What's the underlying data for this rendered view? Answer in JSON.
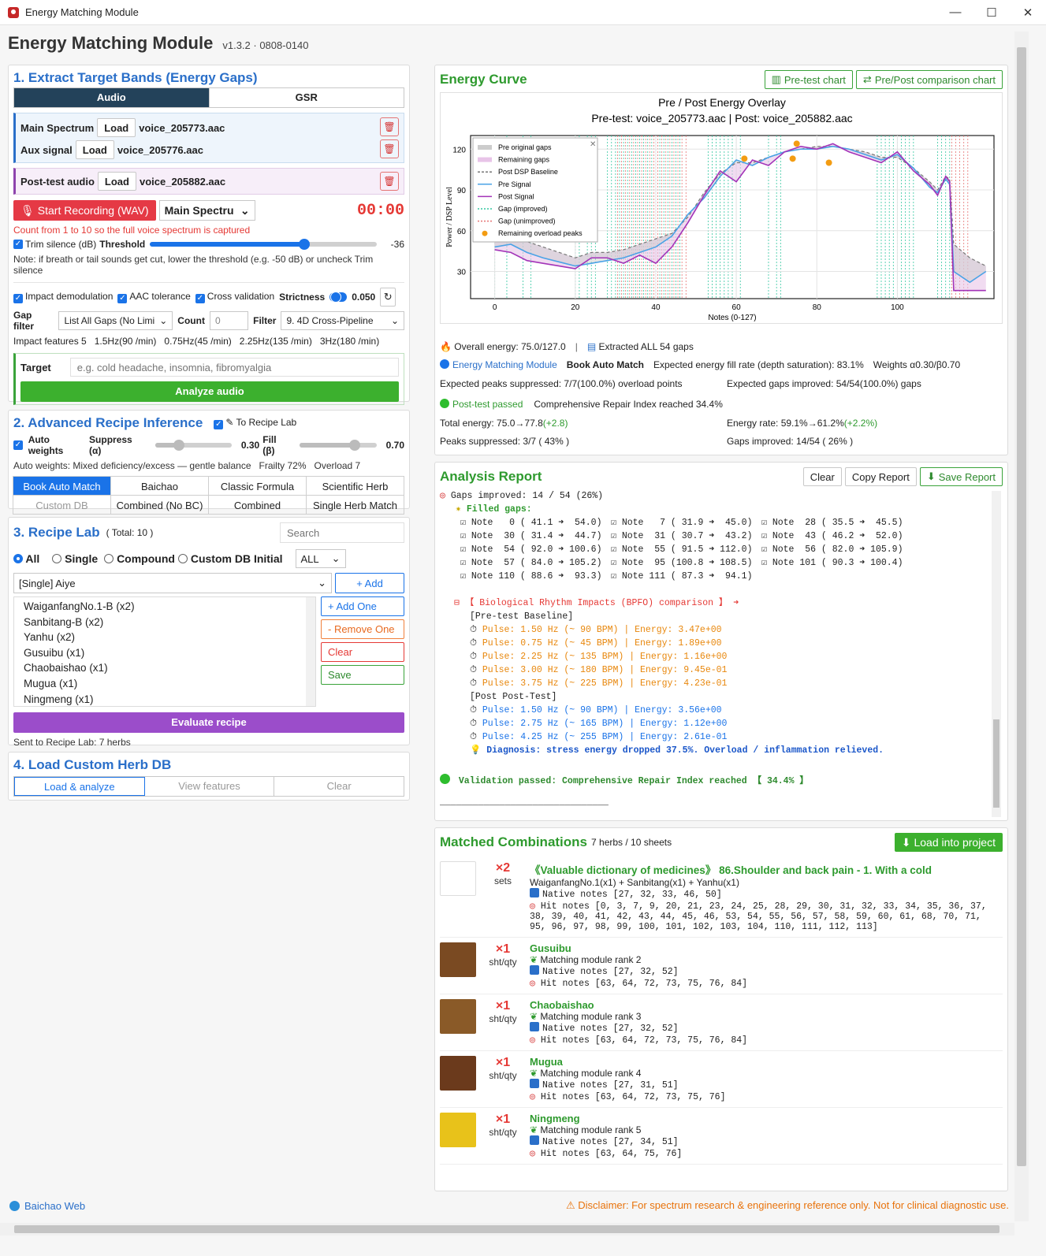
{
  "window": {
    "title": "Energy Matching Module",
    "minimize": "—",
    "maximize": "☐",
    "close": "✕"
  },
  "header": {
    "title": "Energy Matching Module",
    "version": "v1.3.2 · 0808-0140"
  },
  "s1": {
    "title": "1. Extract Target Bands (Energy Gaps)",
    "tabs": [
      "Audio",
      "GSR"
    ],
    "main_label": "Main Spectrum",
    "main_file": "voice_205773.aac",
    "aux_label": "Aux signal",
    "aux_file": "voice_205776.aac",
    "post_label": "Post-test audio",
    "post_file": "voice_205882.aac",
    "load": "Load",
    "record": "Start Recording (WAV)",
    "channel": "Main Spectru",
    "timer": "00:00",
    "hint": "Count from 1 to 10 so the full voice spectrum is captured",
    "trim": "Trim silence (dB)",
    "threshold_label": "Threshold",
    "threshold_value": "-36",
    "threshold_level": 0.68,
    "note": "Note: if breath or tail sounds get cut, lower the threshold (e.g. -50 dB) or uncheck Trim silence",
    "impact": "Impact demodulation",
    "aac": "AAC tolerance",
    "cross": "Cross validation",
    "strictness_label": "Strictness",
    "strictness": "0.050",
    "gapfilter_label": "Gap filter",
    "gapfilter": "List All Gaps (No Limi",
    "count_label": "Count",
    "count": "0",
    "filter_label": "Filter",
    "filter": "9. 4D Cross-Pipeline",
    "features": [
      "Impact features 5",
      "1.5Hz(90 /min)",
      "0.75Hz(45 /min)",
      "2.25Hz(135 /min)",
      "3Hz(180 /min)"
    ],
    "target_label": "Target",
    "target_placeholder": "e.g. cold headache, insomnia, fibromyalgia",
    "analyze": "Analyze audio"
  },
  "s2": {
    "title": "2. Advanced Recipe Inference",
    "to_lab": "To Recipe Lab",
    "auto": "Auto weights",
    "suppress_label": "Suppress (α)",
    "suppress": "0.30",
    "fill_label": "Fill (β)",
    "fill": "0.70",
    "suppress_level": 0.3,
    "fill_level": 0.7,
    "desc": "Auto weights: Mixed deficiency/excess — gentle balance",
    "frailty": "Frailty 72%",
    "overload": "Overload 7",
    "modes": [
      "Book Auto Match",
      "Baichao",
      "Classic Formula",
      "Scientific Herb",
      "Custom DB",
      "Combined (No BC)",
      "Combined",
      "Single Herb Match"
    ]
  },
  "s3": {
    "title": "3. Recipe Lab",
    "total": "( Total: 10 )",
    "search_placeholder": "Search",
    "radios": [
      "All",
      "Single",
      "Compound",
      "Custom DB Initial"
    ],
    "initial": "ALL",
    "selected": "[Single] Aiye",
    "add": "+ Add",
    "items": [
      "WaiganfangNo.1-B (x2)",
      "Sanbitang-B (x2)",
      "Yanhu (x2)",
      "Gusuibu (x1)",
      "Chaobaishao (x1)",
      "Mugua (x1)",
      "Ningmeng (x1)"
    ],
    "add_one": "+ Add One",
    "remove_one": "- Remove One",
    "clear": "Clear",
    "save": "Save",
    "evaluate": "Evaluate recipe",
    "sent": "Sent to Recipe Lab: 7 herbs"
  },
  "s4": {
    "title": "4. Load Custom Herb DB",
    "buttons": [
      "Load & analyze",
      "View features",
      "Clear"
    ]
  },
  "curve": {
    "title": "Energy Curve",
    "pretest_btn": "Pre-test chart",
    "compare_btn": "Pre/Post comparison chart",
    "overall": "Overall energy: 75.0/127.0",
    "extracted": "Extracted ALL 54 gaps",
    "module": "Energy Matching Module",
    "book": "Book Auto Match",
    "fill_rate": "Expected energy fill rate (depth saturation): 83.1%",
    "weights": "Weights α0.30/β0.70",
    "peaks_expected": "Expected peaks suppressed: 7/7(100.0%) overload points",
    "gaps_expected": "Expected gaps improved: 54/54(100.0%) gaps",
    "passed": "Post-test passed",
    "repair": "Comprehensive Repair Index reached 34.4%",
    "total_energy": "Total energy: 75.0→77.8",
    "total_delta": "(+2.8)",
    "energy_rate": "Energy rate: 59.1%→61.2%",
    "rate_delta": "(+2.2%)",
    "peaks_supp": "Peaks suppressed: 3/7 ( 43% )",
    "gaps_impr": "Gaps improved: 14/54 ( 26% )"
  },
  "chart_data": {
    "type": "line",
    "title": "Pre / Post Energy Overlay",
    "subtitle": "Pre-test: voice_205773.aac   |   Post: voice_205882.aac",
    "xlabel": "Notes (0-127)",
    "ylabel": "Power / DSP Level",
    "xlim": [
      -6,
      124
    ],
    "ylim": [
      10,
      130
    ],
    "xticks": [
      0,
      20,
      40,
      60,
      80,
      100
    ],
    "yticks": [
      30,
      60,
      90,
      120
    ],
    "legend": [
      "Pre original gaps",
      "Remaining gaps",
      "Post DSP Baseline",
      "Pre Signal",
      "Post Signal",
      "Gap (improved)",
      "Gap (unimproved)",
      "Remaining overload peaks"
    ],
    "legend_position": "top-left",
    "colors": {
      "pre": "#4aa3e6",
      "post": "#a334b8",
      "baseline": "#777777",
      "improved": "#33c7a0",
      "unimproved": "#e57373",
      "peak": "#f39c12",
      "gapfill": "#cccccc",
      "remfill": "#e8c4e8"
    },
    "improved_gaps": [
      0,
      3,
      7,
      9,
      20,
      21,
      23,
      24,
      25,
      28,
      29,
      30,
      31,
      32,
      33,
      34,
      35,
      36,
      37,
      38,
      39,
      40,
      41,
      42,
      43,
      44,
      45,
      46,
      53,
      54,
      55,
      56,
      57,
      58,
      59,
      60,
      61,
      68,
      70,
      71,
      95,
      96,
      97,
      98,
      99,
      100,
      101,
      102,
      103,
      104,
      110,
      111,
      112,
      113
    ],
    "unimproved_gaps": [
      30,
      31,
      32,
      33,
      34,
      35,
      36,
      37,
      38,
      39,
      40,
      41,
      42,
      43,
      44,
      45,
      46,
      47,
      113,
      114,
      115,
      116,
      117
    ],
    "pre": {
      "x": [
        0,
        4,
        8,
        12,
        16,
        20,
        24,
        28,
        32,
        36,
        40,
        44,
        48,
        52,
        56,
        60,
        64,
        68,
        72,
        76,
        80,
        84,
        88,
        92,
        96,
        100,
        104,
        108,
        110,
        112,
        113,
        114,
        118,
        122
      ],
      "y": [
        48,
        50,
        44,
        40,
        37,
        34,
        36,
        38,
        40,
        44,
        48,
        56,
        72,
        84,
        100,
        112,
        108,
        114,
        118,
        120,
        120,
        122,
        120,
        116,
        112,
        116,
        106,
        92,
        88,
        98,
        94,
        30,
        22,
        30
      ]
    },
    "post": {
      "x": [
        0,
        4,
        8,
        12,
        16,
        20,
        24,
        28,
        32,
        36,
        40,
        44,
        48,
        52,
        56,
        60,
        64,
        68,
        72,
        76,
        80,
        84,
        88,
        92,
        96,
        100,
        104,
        108,
        110,
        112,
        113,
        114,
        118,
        122
      ],
      "y": [
        46,
        44,
        38,
        36,
        34,
        32,
        40,
        40,
        36,
        42,
        36,
        48,
        66,
        86,
        104,
        96,
        112,
        108,
        118,
        122,
        120,
        124,
        118,
        114,
        110,
        118,
        104,
        94,
        86,
        100,
        96,
        16,
        16,
        16
      ]
    },
    "baseline": {
      "x": [
        0,
        4,
        8,
        12,
        16,
        20,
        24,
        28,
        32,
        36,
        40,
        44,
        48,
        52,
        56,
        60,
        64,
        68,
        72,
        76,
        80,
        84,
        88,
        92,
        96,
        100,
        104,
        108,
        110,
        112,
        113,
        114,
        118,
        122
      ],
      "y": [
        52,
        54,
        52,
        48,
        44,
        40,
        44,
        44,
        46,
        50,
        54,
        58,
        70,
        88,
        102,
        110,
        110,
        114,
        118,
        120,
        122,
        122,
        120,
        118,
        114,
        114,
        106,
        96,
        90,
        100,
        98,
        50,
        40,
        34
      ]
    },
    "peaks": {
      "x": [
        62,
        74,
        75,
        83
      ],
      "y": [
        113,
        113,
        124,
        110
      ]
    }
  },
  "report": {
    "title": "Analysis Report",
    "clear": "Clear",
    "copy": "Copy Report",
    "save": "Save Report",
    "gaps_line": "Gaps improved: 14 / 54 (26%)",
    "filled": "Filled gaps:",
    "notes_rows": [
      [
        "☑ Note   0 ( 41.1 ➜  54.0)",
        "☑ Note   7 ( 31.9 ➜  45.0)",
        "☑ Note  28 ( 35.5 ➜  45.5)"
      ],
      [
        "☑ Note  30 ( 31.4 ➜  44.7)",
        "☑ Note  31 ( 30.7 ➜  43.2)",
        "☑ Note  43 ( 46.2 ➜  52.0)"
      ],
      [
        "☑ Note  54 ( 92.0 ➜ 100.6)",
        "☑ Note  55 ( 91.5 ➜ 112.0)",
        "☑ Note  56 ( 82.0 ➜ 105.9)"
      ],
      [
        "☑ Note  57 ( 84.0 ➜ 105.2)",
        "☑ Note  95 (100.8 ➜ 108.5)",
        "☑ Note 101 ( 90.3 ➜ 100.4)"
      ],
      [
        "☑ Note 110 ( 88.6 ➜  93.3)",
        "☑ Note 111 ( 87.3 ➜  94.1)",
        ""
      ]
    ],
    "bpfo": "【 Biological Rhythm Impacts (BPFO) comparison 】 ➜",
    "pre_head": "[Pre-test Baseline]",
    "pre_lines": [
      "Pulse: 1.50 Hz (~ 90 BPM) | Energy: 3.47e+00",
      "Pulse: 0.75 Hz (~ 45 BPM) | Energy: 1.89e+00",
      "Pulse: 2.25 Hz (~ 135 BPM) | Energy: 1.16e+00",
      "Pulse: 3.00 Hz (~ 180 BPM) | Energy: 9.45e-01",
      "Pulse: 3.75 Hz (~ 225 BPM) | Energy: 4.23e-01"
    ],
    "post_head": "[Post Post-Test]",
    "post_lines": [
      "Pulse: 1.50 Hz (~ 90 BPM) | Energy: 3.56e+00",
      "Pulse: 2.75 Hz (~ 165 BPM) | Energy: 1.12e+00",
      "Pulse: 4.25 Hz (~ 255 BPM) | Energy: 2.61e-01"
    ],
    "diagnosis": "Diagnosis: stress energy dropped 37.5%. Overload / inflammation relieved.",
    "validation": "Validation passed: Comprehensive Repair Index reached 【 34.4% 】",
    "rule": "_______________________________"
  },
  "matched": {
    "title": "Matched Combinations",
    "sub": "7 herbs / 10 sheets",
    "load": "Load into project",
    "first": {
      "qty": "×2",
      "unit": "sets",
      "name": "《Valuable dictionary of medicines》 86.Shoulder and back pain - 1. With a cold",
      "formula": "WaiganfangNo.1(x1) + Sanbitang(x1) + Yanhu(x1)",
      "native": "Native notes [27, 32, 33, 46, 50]",
      "hits": "Hit notes [0, 3, 7, 9, 20, 21, 23, 24, 25, 28, 29, 30, 31, 32, 33, 34, 35, 36, 37, 38, 39, 40, 41, 42, 43, 44, 45, 46, 53, 54, 55, 56, 57, 58, 59, 60, 61, 68, 70, 71, 95, 96, 97, 98, 99, 100, 101, 102, 103, 104, 110, 111, 112, 113]"
    },
    "herbs": [
      {
        "qty": "×1",
        "unit": "sht/qty",
        "name": "Gusuibu",
        "rank": "Matching module rank 2",
        "native": "Native notes [27, 32, 52]",
        "hits": "Hit notes [63, 64, 72, 73, 75, 76, 84]",
        "color": "#7a4a22"
      },
      {
        "qty": "×1",
        "unit": "sht/qty",
        "name": "Chaobaishao",
        "rank": "Matching module rank 3",
        "native": "Native notes [27, 32, 52]",
        "hits": "Hit notes [63, 64, 72, 73, 75, 76, 84]",
        "color": "#8a5a28"
      },
      {
        "qty": "×1",
        "unit": "sht/qty",
        "name": "Mugua",
        "rank": "Matching module rank 4",
        "native": "Native notes [27, 31, 51]",
        "hits": "Hit notes [63, 64, 72, 73, 75, 76]",
        "color": "#6b3a1c"
      },
      {
        "qty": "×1",
        "unit": "sht/qty",
        "name": "Ningmeng",
        "rank": "Matching module rank 5",
        "native": "Native notes [27, 34, 51]",
        "hits": "Hit notes [63, 64, 75, 76]",
        "color": "#e8c21a"
      }
    ]
  },
  "footer": {
    "web": "Baichao Web",
    "disclaimer": "Disclaimer: For spectrum research & engineering reference only. Not for clinical diagnostic use."
  }
}
